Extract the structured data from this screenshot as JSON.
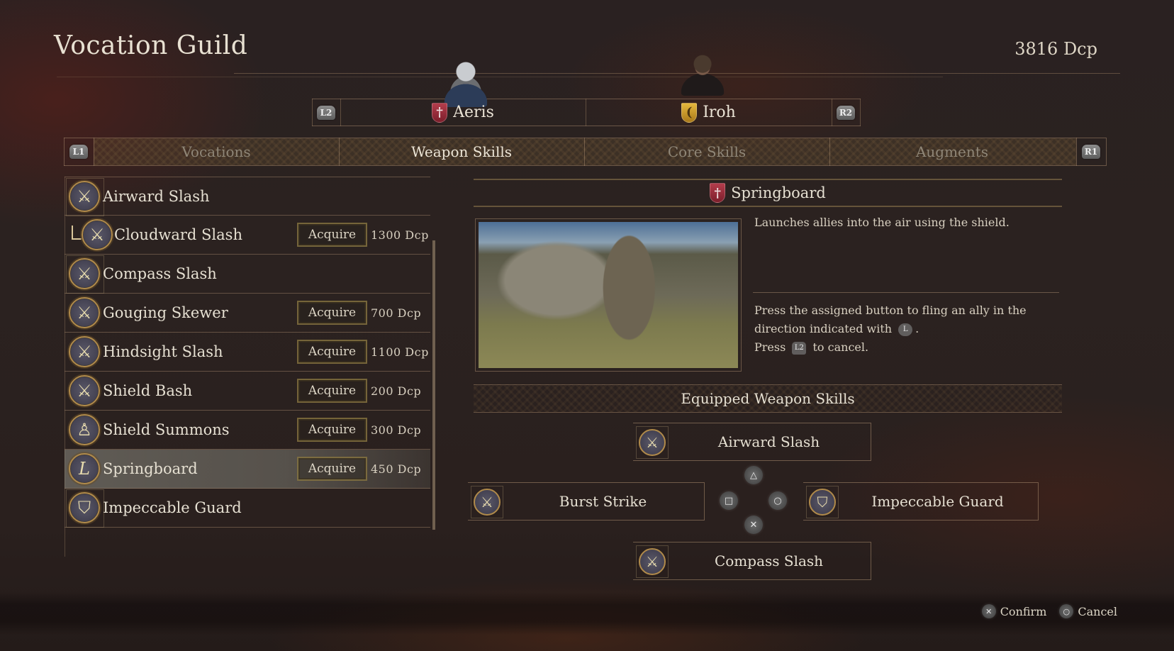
{
  "header": {
    "title": "Vocation Guild",
    "currency": "3816 Dcp"
  },
  "characters": {
    "prev_button": "L2",
    "next_button": "R2",
    "tabs": [
      {
        "name": "Aeris",
        "crest_color": "#b33d4c",
        "crest_icon": "sword-crest-icon",
        "active": true
      },
      {
        "name": "Iroh",
        "crest_color": "#e5b73d",
        "crest_icon": "bow-crest-icon",
        "active": false
      }
    ]
  },
  "sections": {
    "prev_button": "L1",
    "next_button": "R1",
    "tabs": [
      {
        "label": "Vocations",
        "active": false
      },
      {
        "label": "Weapon Skills",
        "active": true
      },
      {
        "label": "Core Skills",
        "active": false
      },
      {
        "label": "Augments",
        "active": false
      }
    ]
  },
  "skills": [
    {
      "name": "Airward Slash",
      "icon": "sword-icon",
      "equipped": true,
      "acquire": null,
      "cost": null
    },
    {
      "name": "Cloudward Slash",
      "icon": "sword-icon",
      "upgrade_of_previous": true,
      "acquire": "Acquire",
      "cost": "1300  Dcp"
    },
    {
      "name": "Compass Slash",
      "icon": "sword-icon",
      "equipped": true,
      "acquire": null,
      "cost": null
    },
    {
      "name": "Gouging Skewer",
      "icon": "sword-icon",
      "acquire": "Acquire",
      "cost": "700  Dcp"
    },
    {
      "name": "Hindsight Slash",
      "icon": "sword-icon",
      "acquire": "Acquire",
      "cost": "1100  Dcp"
    },
    {
      "name": "Shield Bash",
      "icon": "sword-icon",
      "acquire": "Acquire",
      "cost": "200  Dcp"
    },
    {
      "name": "Shield Summons",
      "icon": "figure-icon",
      "acquire": "Acquire",
      "cost": "300  Dcp"
    },
    {
      "name": "Springboard",
      "icon": "boot-icon",
      "selected": true,
      "acquire": "Acquire",
      "cost": "450  Dcp"
    },
    {
      "name": "Impeccable Guard",
      "icon": "shield-icon",
      "equipped": true,
      "acquire": null,
      "cost": null
    }
  ],
  "detail": {
    "title": "Springboard",
    "crest_icon": "sword-crest-icon",
    "description": "Launches allies into the air using the shield.",
    "howto_line1": "Press the assigned button to fling an ally in the",
    "howto_line2a": "direction indicated with",
    "howto_glyph_stick": "L",
    "howto_line2b": ".",
    "howto_line3a": "Press",
    "howto_glyph_cancel": "L2",
    "howto_line3b": "to cancel."
  },
  "equipped": {
    "title": "Equipped Weapon Skills",
    "slots": {
      "triangle": {
        "button": "△",
        "skill": "Airward Slash",
        "icon": "sword-icon"
      },
      "square": {
        "button": "□",
        "skill": "Burst Strike",
        "icon": "sword-icon"
      },
      "circle": {
        "button": "○",
        "skill": "Impeccable Guard",
        "icon": "shield-icon"
      },
      "cross": {
        "button": "✕",
        "skill": "Compass Slash",
        "icon": "sword-icon"
      }
    }
  },
  "footer": {
    "confirm_button": "✕",
    "confirm_label": "Confirm",
    "cancel_button": "○",
    "cancel_label": "Cancel"
  }
}
